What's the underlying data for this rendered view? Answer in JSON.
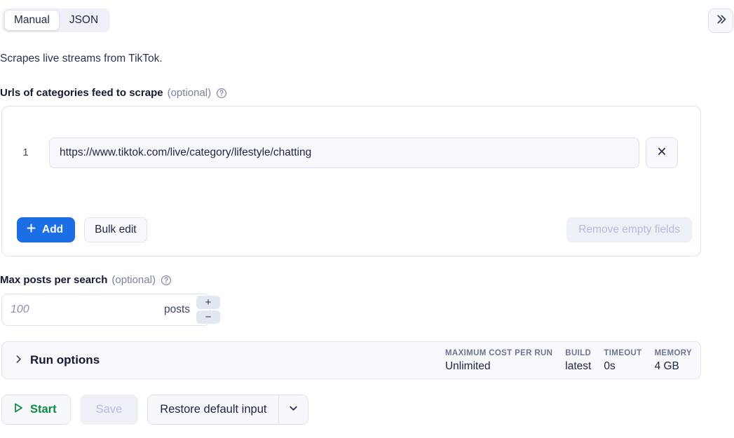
{
  "tabs": {
    "items": [
      {
        "label": "Manual",
        "active": true
      },
      {
        "label": "JSON",
        "active": false
      }
    ],
    "collapse_icon": "chevrons-right-icon"
  },
  "description": "Scrapes live streams from TikTok.",
  "urls_field": {
    "label": "Urls of categories feed to scrape",
    "optional": "(optional)",
    "help_icon": "question-circle-icon",
    "rows": [
      {
        "index": "1",
        "value": "https://www.tiktok.com/live/category/lifestyle/chatting",
        "placeholder": "",
        "remove_icon": "close-icon"
      }
    ],
    "add_label": "Add",
    "add_icon": "plus-icon",
    "bulk_edit_label": "Bulk edit",
    "remove_empty_label": "Remove empty fields"
  },
  "max_posts_field": {
    "label": "Max posts per search",
    "optional": "(optional)",
    "help_icon": "question-circle-icon",
    "value": "",
    "placeholder": "100",
    "unit": "posts",
    "increment_label": "+",
    "decrement_label": "−"
  },
  "run_options": {
    "title": "Run options",
    "expand_icon": "chevron-right-icon",
    "meta": [
      {
        "label": "MAXIMUM COST PER RUN",
        "value": "Unlimited"
      },
      {
        "label": "BUILD",
        "value": "latest"
      },
      {
        "label": "TIMEOUT",
        "value": "0s"
      },
      {
        "label": "MEMORY",
        "value": "4 GB"
      }
    ]
  },
  "actions": {
    "start_label": "Start",
    "start_icon": "play-icon",
    "save_label": "Save",
    "restore_label": "Restore default input",
    "restore_dropdown_icon": "chevron-down-icon"
  },
  "colors": {
    "accent_blue": "#1b6ee3",
    "start_green": "#0d8a41",
    "muted_text": "#7a819b",
    "disabled_text": "#b7bcd4",
    "panel_border": "#dfe2f0"
  }
}
